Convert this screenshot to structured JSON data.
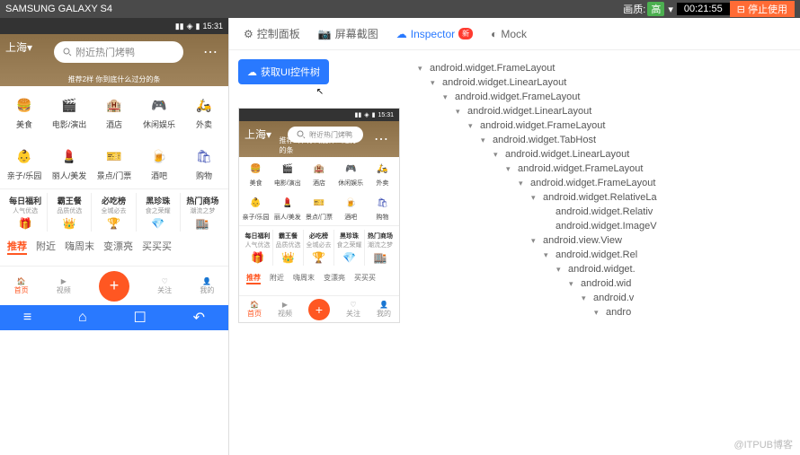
{
  "topbar": {
    "device": "SAMSUNG GALAXY S4",
    "quality_label": "画质:",
    "quality_value": "高",
    "timer": "00:21:55",
    "stop": "⊟ 停止使用"
  },
  "status": {
    "time": "15:31",
    "signal": "📶",
    "wifi": "📡",
    "battery": "🔋"
  },
  "hero": {
    "city": "上海",
    "placeholder": "附近热门烤鸭",
    "subtitle": "推荐2样 你到底什么过分的条"
  },
  "grid1": [
    {
      "icon": "🍔",
      "label": "美食",
      "color": "#ff9800"
    },
    {
      "icon": "🎬",
      "label": "电影/演出",
      "color": "#e91e63"
    },
    {
      "icon": "🏨",
      "label": "酒店",
      "color": "#2196f3"
    },
    {
      "icon": "🎮",
      "label": "休闲娱乐",
      "color": "#9c27b0"
    },
    {
      "icon": "🛵",
      "label": "外卖",
      "color": "#ffc107"
    }
  ],
  "grid2": [
    {
      "icon": "👶",
      "label": "亲子/乐园",
      "color": "#ff5722"
    },
    {
      "icon": "💄",
      "label": "丽人/美发",
      "color": "#e91e63"
    },
    {
      "icon": "🎫",
      "label": "景点/门票",
      "color": "#ff9800"
    },
    {
      "icon": "🍺",
      "label": "酒吧",
      "color": "#673ab7"
    },
    {
      "icon": "🛍",
      "label": "购物",
      "color": "#3f51b5"
    }
  ],
  "promos": [
    {
      "title": "每日福利",
      "sub": "人气优选",
      "icon": "🎁"
    },
    {
      "title": "霸王餐",
      "sub": "品质优选",
      "icon": "👑"
    },
    {
      "title": "必吃榜",
      "sub": "全城必去",
      "icon": "🏆"
    },
    {
      "title": "黑珍珠",
      "sub": "食之荣耀",
      "icon": "💎"
    },
    {
      "title": "热门商场",
      "sub": "潮流之梦",
      "icon": "🏬"
    }
  ],
  "tabs": [
    "推荐",
    "附近",
    "嗨周末",
    "变漂亮",
    "买买买"
  ],
  "nav": [
    {
      "icon": "🏠",
      "label": "首页"
    },
    {
      "icon": "▶",
      "label": "视频"
    },
    {
      "icon": "+",
      "label": ""
    },
    {
      "icon": "♡",
      "label": "关注"
    },
    {
      "icon": "👤",
      "label": "我的"
    }
  ],
  "inspector": {
    "tabs": [
      {
        "icon": "⚙",
        "label": "控制面板"
      },
      {
        "icon": "📷",
        "label": "屏幕截图"
      },
      {
        "icon": "☁",
        "label": "Inspector",
        "badge": "新"
      },
      {
        "icon": "◐",
        "label": "Mock"
      }
    ],
    "get_tree": "获取UI控件树"
  },
  "tree": [
    {
      "d": 0,
      "t": "android.widget.FrameLayout"
    },
    {
      "d": 1,
      "t": "android.widget.LinearLayout"
    },
    {
      "d": 2,
      "t": "android.widget.FrameLayout"
    },
    {
      "d": 3,
      "t": "android.widget.LinearLayout"
    },
    {
      "d": 4,
      "t": "android.widget.FrameLayout"
    },
    {
      "d": 5,
      "t": "android.widget.TabHost"
    },
    {
      "d": 6,
      "t": "android.widget.LinearLayout"
    },
    {
      "d": 7,
      "t": "android.widget.FrameLayout"
    },
    {
      "d": 8,
      "t": "android.widget.FrameLayout"
    },
    {
      "d": 9,
      "t": "android.widget.RelativeLa"
    },
    {
      "d": 10,
      "t": "android.widget.Relativ",
      "leaf": true
    },
    {
      "d": 10,
      "t": "android.widget.ImageV",
      "leaf": true
    },
    {
      "d": 9,
      "t": "android.view.View"
    },
    {
      "d": 10,
      "t": "android.widget.Rel"
    },
    {
      "d": 11,
      "t": "android.widget."
    },
    {
      "d": 12,
      "t": "android.wid"
    },
    {
      "d": 13,
      "t": "android.v"
    },
    {
      "d": 14,
      "t": "andro"
    }
  ],
  "watermark": "@ITPUB博客"
}
